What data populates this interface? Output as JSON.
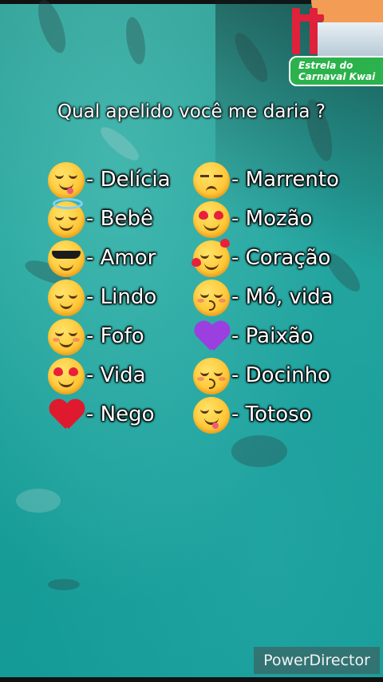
{
  "badge": {
    "line1": "Estrela do",
    "line2": "Carnaval Kwai"
  },
  "question": "Qual apelido você me daria ?",
  "left_items": [
    {
      "icon": "yum-face-icon",
      "label": "- Delícia"
    },
    {
      "icon": "halo-face-icon",
      "label": "- Bebê"
    },
    {
      "icon": "sunglasses-face-icon",
      "label": "- Amor"
    },
    {
      "icon": "relieved-face-icon",
      "label": "- Lindo"
    },
    {
      "icon": "blush-face-icon",
      "label": "- Fofo"
    },
    {
      "icon": "heart-eyes-face-icon",
      "label": "- Vida"
    },
    {
      "icon": "red-heart-icon",
      "label": "- Nego"
    }
  ],
  "right_items": [
    {
      "icon": "unamused-face-icon",
      "label": "- Marrento"
    },
    {
      "icon": "heart-eyes-face-icon",
      "label": "- Mozão"
    },
    {
      "icon": "smiling-face-hearts-icon",
      "label": "- Coração"
    },
    {
      "icon": "kissing-face-icon",
      "label": "- Mó, vida"
    },
    {
      "icon": "purple-heart-icon",
      "label": "- Paixão"
    },
    {
      "icon": "kissing-face-icon",
      "label": "- Docinho"
    },
    {
      "icon": "yum-face-icon",
      "label": "- Totoso"
    }
  ],
  "watermark": "PowerDirector",
  "colors": {
    "water": "#1f9f99",
    "badge_green": "#2bb24c",
    "text": "#ffffff"
  }
}
